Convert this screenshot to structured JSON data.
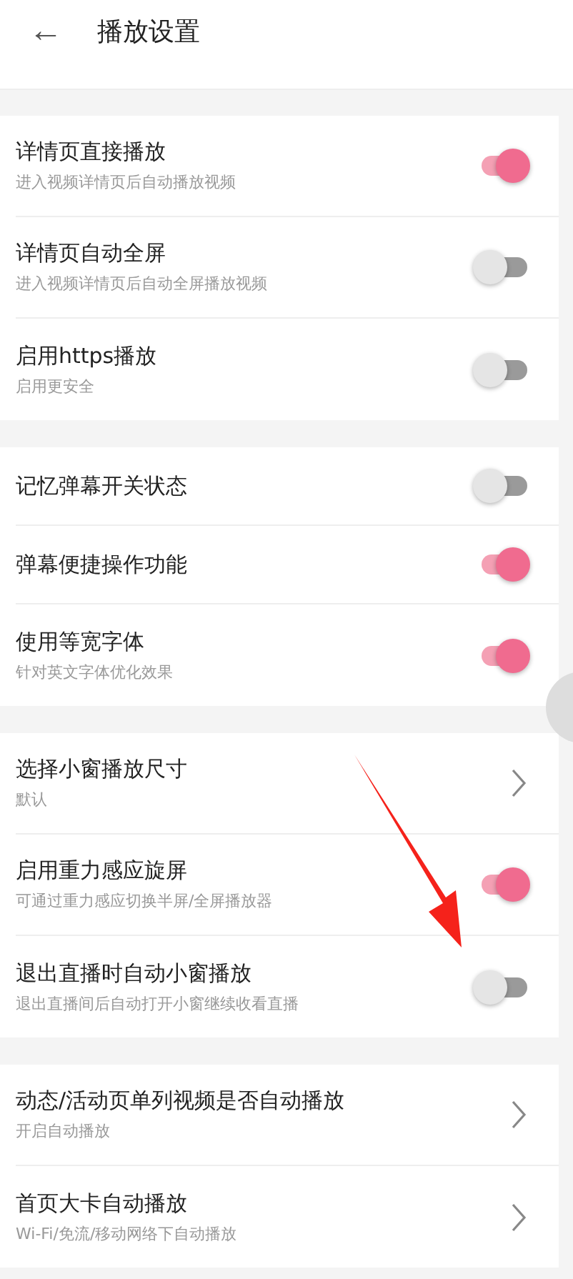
{
  "header": {
    "back": "←",
    "title": "播放设置"
  },
  "sections": [
    {
      "items": [
        {
          "kind": "toggle",
          "title": "详情页直接播放",
          "subtitle": "进入视频详情页后自动播放视频",
          "on": true
        },
        {
          "kind": "toggle",
          "title": "详情页自动全屏",
          "subtitle": "进入视频详情页后自动全屏播放视频",
          "on": false
        },
        {
          "kind": "toggle",
          "title": "启用https播放",
          "subtitle": "启用更安全",
          "on": false
        }
      ]
    },
    {
      "items": [
        {
          "kind": "toggle",
          "title": "记忆弹幕开关状态",
          "on": false
        },
        {
          "kind": "toggle",
          "title": "弹幕便捷操作功能",
          "on": true
        },
        {
          "kind": "toggle",
          "title": "使用等宽字体",
          "subtitle": "针对英文字体优化效果",
          "on": true
        }
      ]
    },
    {
      "items": [
        {
          "kind": "link",
          "title": "选择小窗播放尺寸",
          "subtitle": "默认"
        },
        {
          "kind": "toggle",
          "title": "启用重力感应旋屏",
          "subtitle": "可通过重力感应切换半屏/全屏播放器",
          "on": true
        },
        {
          "kind": "toggle",
          "title": "退出直播时自动小窗播放",
          "subtitle": "退出直播间后自动打开小窗继续收看直播",
          "on": false
        }
      ]
    },
    {
      "items": [
        {
          "kind": "link",
          "title": "动态/活动页单列视频是否自动播放",
          "subtitle": "开启自动播放"
        },
        {
          "kind": "link",
          "title": "首页大卡自动播放",
          "subtitle": "Wi-Fi/免流/移动网络下自动播放"
        }
      ]
    }
  ]
}
